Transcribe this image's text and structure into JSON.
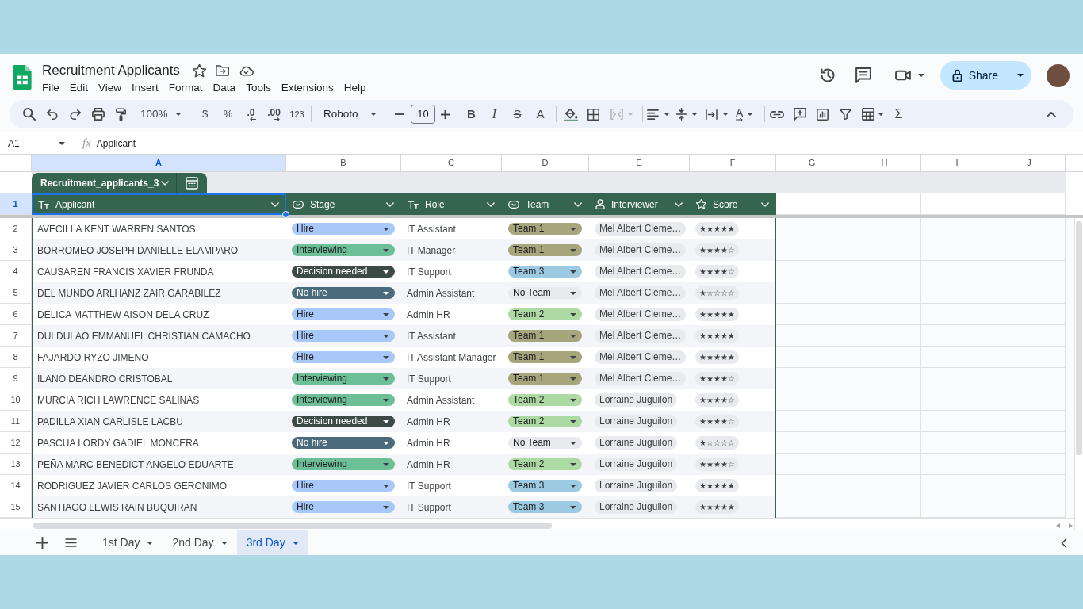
{
  "document": {
    "title": "Recruitment Applicants"
  },
  "menu": [
    "File",
    "Edit",
    "View",
    "Insert",
    "Format",
    "Data",
    "Tools",
    "Extensions",
    "Help"
  ],
  "share_button": {
    "label": "Share"
  },
  "toolbar": {
    "zoom": "100%",
    "currency": "$",
    "percent": "%",
    "decrease_decimal": ".0",
    "increase_decimal": ".00",
    "number_format": "123",
    "font": "Roboto",
    "font_size": "10",
    "bold": "B",
    "italic": "I",
    "strikethrough": "S",
    "text_color": "A",
    "text_rotation": "A",
    "functions": "Σ"
  },
  "formula_bar": {
    "cell_reference": "A1",
    "function_symbol": "fx",
    "value": "Applicant"
  },
  "column_letters": [
    {
      "label": "A",
      "selected": true
    },
    {
      "label": "B",
      "selected": false
    },
    {
      "label": "C",
      "selected": false
    },
    {
      "label": "D",
      "selected": false
    },
    {
      "label": "E",
      "selected": false
    },
    {
      "label": "F",
      "selected": false
    },
    {
      "label": "G",
      "selected": false
    },
    {
      "label": "H",
      "selected": false
    },
    {
      "label": "I",
      "selected": false
    },
    {
      "label": "J",
      "selected": false
    }
  ],
  "row_numbers": [
    {
      "label": "1",
      "selected": true
    },
    {
      "label": "2",
      "selected": false
    },
    {
      "label": "3",
      "selected": false
    },
    {
      "label": "4",
      "selected": false
    },
    {
      "label": "5",
      "selected": false
    },
    {
      "label": "6",
      "selected": false
    },
    {
      "label": "7",
      "selected": false
    },
    {
      "label": "8",
      "selected": false
    },
    {
      "label": "9",
      "selected": false
    },
    {
      "label": "10",
      "selected": false
    },
    {
      "label": "11",
      "selected": false
    },
    {
      "label": "12",
      "selected": false
    },
    {
      "label": "13",
      "selected": false
    },
    {
      "label": "14",
      "selected": false
    },
    {
      "label": "15",
      "selected": false
    }
  ],
  "table": {
    "name": "Recruitment_applicants_3",
    "columns": [
      {
        "label": "Applicant",
        "kind": "text"
      },
      {
        "label": "Stage",
        "kind": "dropdown"
      },
      {
        "label": "Role",
        "kind": "text"
      },
      {
        "label": "Team",
        "kind": "dropdown"
      },
      {
        "label": "Interviewer",
        "kind": "person"
      },
      {
        "label": "Score",
        "kind": "rating"
      }
    ],
    "rows": [
      {
        "applicant": "AVECILLA KENT WARREN SANTOS",
        "stage": {
          "label": "Hire",
          "color": "#a8c8fa"
        },
        "role": "IT Assistant",
        "team": {
          "label": "Team 1",
          "color": "#a6a57c"
        },
        "interviewer": "Mel Albert Cleme…",
        "score": "★★★★★"
      },
      {
        "applicant": "BORROMEO JOSEPH DANIELLE ELAMPARO",
        "stage": {
          "label": "Interviewing",
          "color": "#6dbf98"
        },
        "role": "IT Manager",
        "team": {
          "label": "Team 1",
          "color": "#a6a57c"
        },
        "interviewer": "Mel Albert Cleme…",
        "score": "★★★★☆"
      },
      {
        "applicant": "CAUSAREN FRANCIS XAVIER FRUNDA",
        "stage": {
          "label": "Decision needed",
          "color": "#3e4a45"
        },
        "role": "IT Support",
        "team": {
          "label": "Team 3",
          "color": "#9dcae3"
        },
        "interviewer": "Mel Albert Cleme…",
        "score": "★★★★☆"
      },
      {
        "applicant": "DEL MUNDO ARLHANZ ZAIR GARABILEZ",
        "stage": {
          "label": "No hire",
          "color": "#4b6b7d"
        },
        "role": "Admin Assistant",
        "team": {
          "label": "No Team",
          "color": "#e8eaed"
        },
        "interviewer": "Mel Albert Cleme…",
        "score": "★☆☆☆☆"
      },
      {
        "applicant": "DELICA MATTHEW AISON DELA CRUZ",
        "stage": {
          "label": "Hire",
          "color": "#a8c8fa"
        },
        "role": "Admin HR",
        "team": {
          "label": "Team 2",
          "color": "#acdaa2"
        },
        "interviewer": "Mel Albert Cleme…",
        "score": "★★★★★"
      },
      {
        "applicant": "DULDULAO EMMANUEL CHRISTIAN CAMACHO",
        "stage": {
          "label": "Hire",
          "color": "#a8c8fa"
        },
        "role": "IT Assistant",
        "team": {
          "label": "Team 1",
          "color": "#a6a57c"
        },
        "interviewer": "Mel Albert Cleme…",
        "score": "★★★★★"
      },
      {
        "applicant": "FAJARDO RYZO JIMENO",
        "stage": {
          "label": "Hire",
          "color": "#a8c8fa"
        },
        "role": "IT Assistant Manager",
        "team": {
          "label": "Team 1",
          "color": "#a6a57c"
        },
        "interviewer": "Mel Albert Cleme…",
        "score": "★★★★★"
      },
      {
        "applicant": "ILANO DEANDRO CRISTOBAL",
        "stage": {
          "label": "Interviewing",
          "color": "#6dbf98"
        },
        "role": "IT Support",
        "team": {
          "label": "Team 1",
          "color": "#a6a57c"
        },
        "interviewer": "Mel Albert Cleme…",
        "score": "★★★★☆"
      },
      {
        "applicant": "MURCIA RICH LAWRENCE SALINAS",
        "stage": {
          "label": "Interviewing",
          "color": "#6dbf98"
        },
        "role": "Admin Assistant",
        "team": {
          "label": "Team 2",
          "color": "#acdaa2"
        },
        "interviewer": "Lorraine Juguilon",
        "score": "★★★★☆"
      },
      {
        "applicant": "PADILLA XIAN CARLISLE LACBU",
        "stage": {
          "label": "Decision needed",
          "color": "#3e4a45"
        },
        "role": "Admin HR",
        "team": {
          "label": "Team 2",
          "color": "#acdaa2"
        },
        "interviewer": "Lorraine Juguilon",
        "score": "★★★★☆"
      },
      {
        "applicant": "PASCUA LORDY GADIEL MONCERA",
        "stage": {
          "label": "No hire",
          "color": "#4b6b7d"
        },
        "role": "Admin HR",
        "team": {
          "label": "No Team",
          "color": "#e8eaed"
        },
        "interviewer": "Lorraine Juguilon",
        "score": "★☆☆☆☆"
      },
      {
        "applicant": "PEÑA MARC BENEDICT ANGELO EDUARTE",
        "stage": {
          "label": "Interviewing",
          "color": "#6dbf98"
        },
        "role": "Admin HR",
        "team": {
          "label": "Team 2",
          "color": "#acdaa2"
        },
        "interviewer": "Lorraine Juguilon",
        "score": "★★★★☆"
      },
      {
        "applicant": "RODRIGUEZ JAVIER CARLOS GERONIMO",
        "stage": {
          "label": "Hire",
          "color": "#a8c8fa"
        },
        "role": "IT Support",
        "team": {
          "label": "Team 3",
          "color": "#9dcae3"
        },
        "interviewer": "Lorraine Juguilon",
        "score": "★★★★★"
      },
      {
        "applicant": "SANTIAGO LEWIS RAIN BUQUIRAN",
        "stage": {
          "label": "Hire",
          "color": "#a8c8fa"
        },
        "role": "IT Support",
        "team": {
          "label": "Team 3",
          "color": "#9dcae3"
        },
        "interviewer": "Lorraine Juguilon",
        "score": "★★★★★"
      }
    ]
  },
  "sheet_tabs": [
    {
      "label": "1st Day",
      "selected": false
    },
    {
      "label": "2nd Day",
      "selected": false
    },
    {
      "label": "3rd Day",
      "selected": true
    }
  ]
}
